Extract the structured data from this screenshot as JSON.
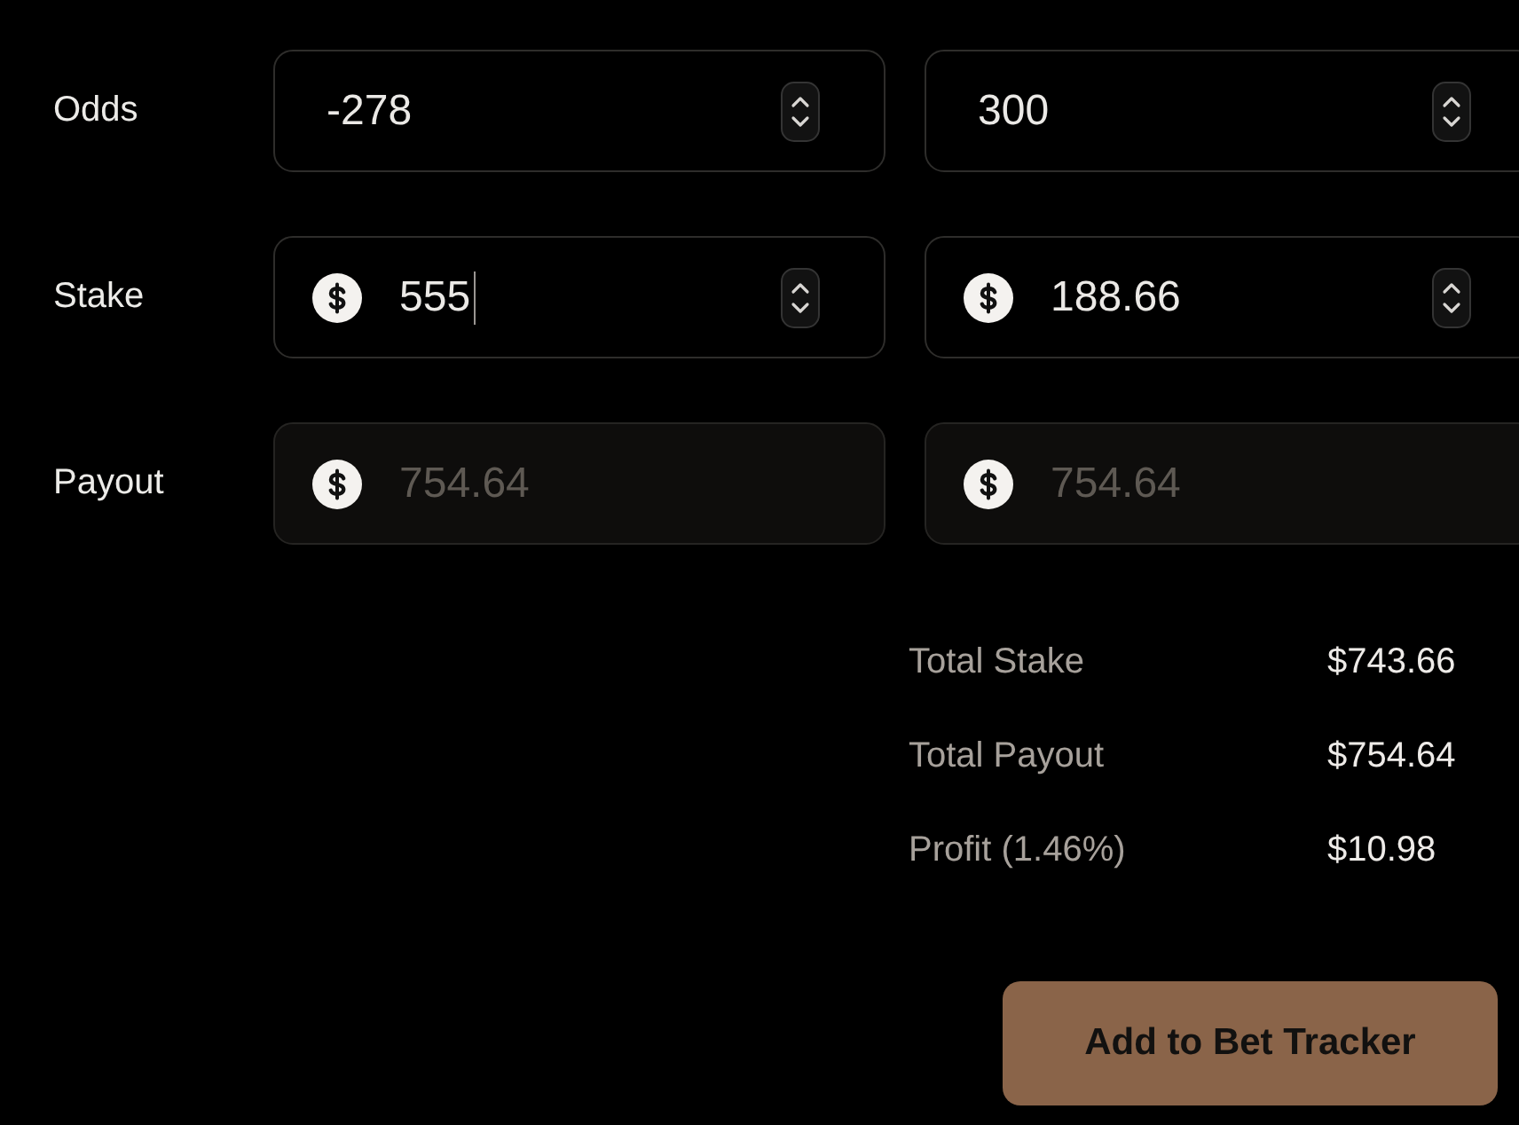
{
  "rows": [
    {
      "label": "Odds",
      "kind": "odds",
      "fields": [
        {
          "value": "-278",
          "disabled": false,
          "focused": false
        },
        {
          "value": "300",
          "disabled": false,
          "focused": false
        }
      ]
    },
    {
      "label": "Stake",
      "kind": "stake",
      "fields": [
        {
          "value": "555",
          "disabled": false,
          "focused": true
        },
        {
          "value": "188.66",
          "disabled": false,
          "focused": false
        }
      ]
    },
    {
      "label": "Payout",
      "kind": "payout",
      "fields": [
        {
          "value": "754.64",
          "disabled": true,
          "focused": false
        },
        {
          "value": "754.64",
          "disabled": true,
          "focused": false
        }
      ]
    }
  ],
  "summary": [
    {
      "label": "Total Stake",
      "value": "$743.66"
    },
    {
      "label": "Total Payout",
      "value": "$754.64"
    },
    {
      "label": "Profit (1.46%)",
      "value": "$10.98"
    }
  ],
  "button": {
    "label": "Add to Bet Tracker"
  }
}
